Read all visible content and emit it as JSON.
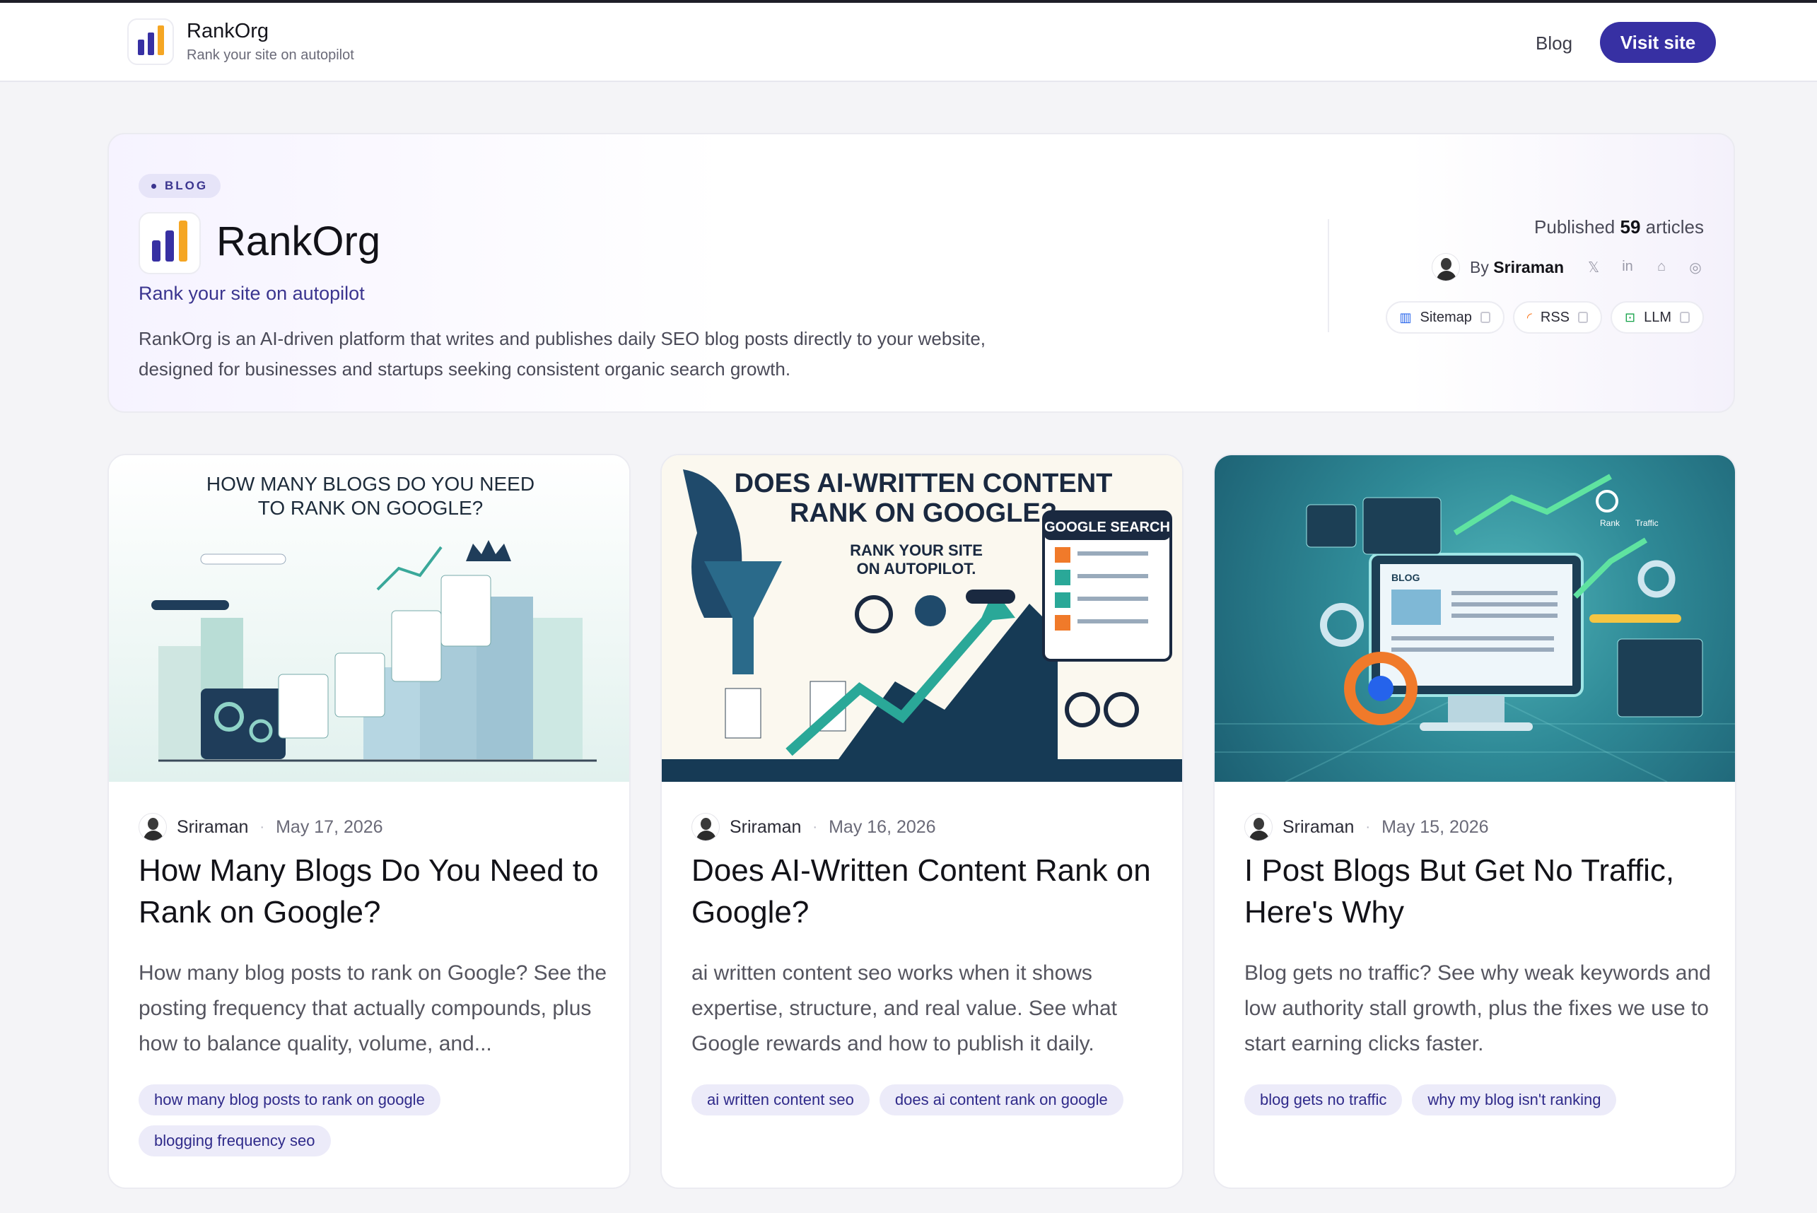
{
  "header": {
    "brand_name": "RankOrg",
    "brand_tagline": "Rank your site on autopilot",
    "nav_blog": "Blog",
    "visit_button": "Visit site"
  },
  "hero": {
    "pill": "BLOG",
    "title": "RankOrg",
    "tagline": "Rank your site on autopilot",
    "description": "RankOrg is an AI-driven platform that writes and publishes daily SEO blog posts directly to your website, designed for businesses and startups seeking consistent organic search growth.",
    "published_prefix": "Published",
    "published_count": "59",
    "published_suffix": "articles",
    "by_prefix": "By",
    "author": "Sriraman",
    "links": [
      {
        "label": "Sitemap",
        "icon": "map-icon"
      },
      {
        "label": "RSS",
        "icon": "rss-icon"
      },
      {
        "label": "LLM",
        "icon": "robot-icon"
      }
    ],
    "social_icons": [
      "x-icon",
      "linkedin-icon",
      "github-icon",
      "globe-icon"
    ]
  },
  "colors": {
    "accent": "#3730a3",
    "logo_bar_1": "#3730a3",
    "logo_bar_2": "#3730a3",
    "logo_bar_3": "#f5a623",
    "tag_bg": "#ecebf9"
  },
  "cards": [
    {
      "image_text": [
        "HOW MANY BLOGS DO YOU NEED",
        "TO RANK ON GOOGLE?"
      ],
      "author": "Sriraman",
      "date": "May 17, 2026",
      "title": "How Many Blogs Do You Need to Rank on Google?",
      "description": "How many blog posts to rank on Google? See the posting frequency that actually compounds, plus how to balance quality, volume, and...",
      "tags": [
        "how many blog posts to rank on google",
        "blogging frequency seo"
      ]
    },
    {
      "image_text": [
        "DOES AI-WRITTEN CONTENT",
        "RANK ON GOOGLE?",
        "RANK YOUR SITE",
        "ON AUTOPILOT.",
        "GOOGLE SEARCH"
      ],
      "author": "Sriraman",
      "date": "May 16, 2026",
      "title": "Does AI-Written Content Rank on Google?",
      "description": "ai written content seo works when it shows expertise, structure, and real value. See what Google rewards and how to publish it daily.",
      "tags": [
        "ai written content seo",
        "does ai content rank on google"
      ]
    },
    {
      "image_text": [
        "BLOG",
        "Rank",
        "Traffic"
      ],
      "author": "Sriraman",
      "date": "May 15, 2026",
      "title": "I Post Blogs But Get No Traffic, Here's Why",
      "description": "Blog gets no traffic? See why weak keywords and low authority stall growth, plus the fixes we use to start earning clicks faster.",
      "tags": [
        "blog gets no traffic",
        "why my blog isn't ranking"
      ]
    }
  ]
}
